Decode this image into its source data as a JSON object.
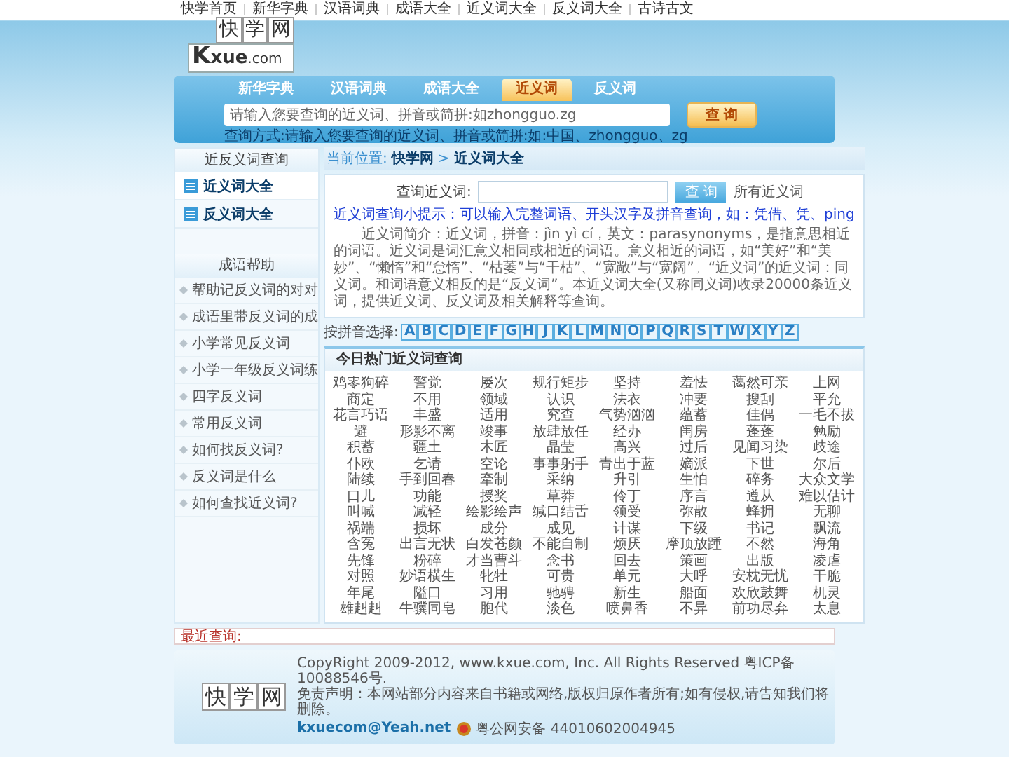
{
  "top_links": [
    "快学首页",
    "新华字典",
    "汉语词典",
    "成语大全",
    "近义词大全",
    "反义词大全",
    "古诗古文"
  ],
  "logo": {
    "chars": [
      "快",
      "学",
      "网"
    ],
    "initial": "K",
    "word": "xue",
    "suffix": ".com"
  },
  "tabs": [
    {
      "label": "新华字典",
      "selected": false
    },
    {
      "label": "汉语词典",
      "selected": false
    },
    {
      "label": "成语大全",
      "selected": false
    },
    {
      "label": "近义词",
      "selected": true
    },
    {
      "label": "反义词",
      "selected": false
    }
  ],
  "search": {
    "placeholder": "请输入您要查询的近义词、拼音或简拼:如zhongguo.zg",
    "button": "查 询",
    "hint": "查询方式:请输入您要查询的近义词、拼音或简拼:如:中国、zhongguo、zg"
  },
  "sidebar": {
    "title": "近反义词查询",
    "items": [
      {
        "label": "近义词大全",
        "selected": true
      },
      {
        "label": "反义词大全",
        "selected": false
      }
    ],
    "help_title": "成语帮助",
    "help_items": [
      "帮助记反义词的对对",
      "成语里带反义词的成",
      "小学常见反义词",
      "小学一年级反义词练",
      "四字反义词",
      "常用反义词",
      "如何找反义词?",
      "反义词是什么",
      "如何查找近义词?"
    ]
  },
  "breadcrumb": {
    "label": "当前位置:",
    "home": "快学网",
    "separator": ">",
    "current": "近义词大全"
  },
  "query_form": {
    "label": "查询近义词:",
    "button": "查 询",
    "link": "所有近义词",
    "tip": "近义词查询小提示：可以输入完整词语、开头汉字及拼音查询，如：凭借、凭、ping",
    "intro": "近义词简介：近义词，拼音：jìn yì cí，英文：parasynonyms，是指意思相近的词语。近义词是词汇意义相同或相近的词语。意义相近的词语，如“美好”和“美妙”、“懒惰”和“怠惰”、“枯萎”与“干枯”、“宽敞”与“宽阔”。“近义词”的近义词：同义词。和词语意义相反的是“反义词”。本近义词大全(又称同义词)收录20000条近义词，提供近义词、反义词及相关解释等查询。"
  },
  "pinyin": {
    "label": "按拼音选择:",
    "letters": [
      "A",
      "B",
      "C",
      "D",
      "E",
      "F",
      "G",
      "H",
      "J",
      "K",
      "L",
      "M",
      "N",
      "O",
      "P",
      "Q",
      "R",
      "S",
      "T",
      "W",
      "X",
      "Y",
      "Z"
    ]
  },
  "hot": {
    "title": "今日热门近义词查询",
    "rows": [
      [
        "鸡零狗碎",
        "警觉",
        "屡次",
        "规行矩步",
        "坚持",
        "羞怯",
        "蔼然可亲",
        "上网"
      ],
      [
        "商定",
        "不用",
        "领域",
        "认识",
        "法衣",
        "冲要",
        "搜刮",
        "平允"
      ],
      [
        "花言巧语",
        "丰盛",
        "适用",
        "究查",
        "气势汹汹",
        "蕴蓄",
        "佳偶",
        "一毛不拔"
      ],
      [
        "避",
        "形影不离",
        "竣事",
        "放肆放任",
        "经办",
        "闺房",
        "蓬蓬",
        "勉励"
      ],
      [
        "积蓄",
        "疆土",
        "木匠",
        "晶莹",
        "高兴",
        "过后",
        "见闻习染",
        "歧途"
      ],
      [
        "仆欧",
        "乞请",
        "空论",
        "事事躬手",
        "青出于蓝",
        "嫡派",
        "下世",
        "尔后"
      ],
      [
        "陆续",
        "手到回春",
        "牵制",
        "采纳",
        "升引",
        "生怕",
        "碎务",
        "大众文学"
      ],
      [
        "口儿",
        "功能",
        "授奖",
        "草莽",
        "伶丁",
        "序言",
        "遵从",
        "难以估计"
      ],
      [
        "叫喊",
        "减轻",
        "绘影绘声",
        "缄口结舌",
        "领受",
        "弥散",
        "蜂拥",
        "无聊"
      ],
      [
        "祸端",
        "损坏",
        "成分",
        "成见",
        "计谋",
        "下级",
        "书记",
        "飘流"
      ],
      [
        "含冤",
        "出言无状",
        "白发苍颜",
        "不能自制",
        "烦厌",
        "摩顶放踵",
        "不然",
        "海角"
      ],
      [
        "先锋",
        "粉碎",
        "才当曹斗",
        "念书",
        "回去",
        "策画",
        "出版",
        "凌虐"
      ],
      [
        "对照",
        "妙语横生",
        "牝牡",
        "可贵",
        "单元",
        "大呼",
        "安枕无忧",
        "干脆"
      ],
      [
        "年尾",
        "隘口",
        "习用",
        "驰骋",
        "新生",
        "船面",
        "欢欣鼓舞",
        "机灵"
      ],
      [
        "雄赳赳",
        "牛骥同皂",
        "胞代",
        "淡色",
        "喷鼻香",
        "不异",
        "前功尽弃",
        "太息"
      ]
    ]
  },
  "recent": {
    "label": "最近查询:"
  },
  "footer": {
    "logo_chars": [
      "快",
      "学",
      "网"
    ],
    "copyright": "CopyRight 2009-2012, www.kxue.com, Inc. All Rights Reserved 粤ICP备10088546号.",
    "disclaimer": "免责声明：本网站部分内容来自书籍或网络,版权归原作者所有;如有侵权,请告知我们将删除。",
    "email": "kxuecom@Yeah.net",
    "police": "粤公网安备 44010602004945"
  }
}
